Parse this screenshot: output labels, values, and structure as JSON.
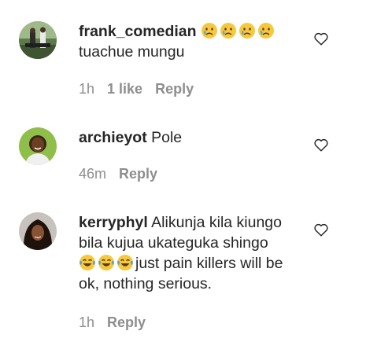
{
  "comments": [
    {
      "username": "frank_comedian",
      "emojis": [
        "crying-face-emoji",
        "crying-face-emoji",
        "crying-face-emoji",
        "crying-face-emoji"
      ],
      "text": "tuachue mungu",
      "time": "1h",
      "likes": "1 like",
      "reply": "Reply"
    },
    {
      "username": "archieyot",
      "text": "Pole",
      "time": "46m",
      "reply": "Reply"
    },
    {
      "username": "kerryphyl",
      "text_before": "Alikunja kila kiungo bila kujua ukateguka shingo",
      "emojis": [
        "laughing-tears-emoji",
        "laughing-tears-emoji",
        "laughing-tears-emoji"
      ],
      "text_after": "just pain killers will be ok, nothing serious.",
      "time": "1h",
      "reply": "Reply"
    }
  ],
  "colors": {
    "text": "#262626",
    "secondary": "#8e8e8e",
    "emoji_face": "#f6c83c",
    "emoji_tear": "#4aa3e8"
  }
}
